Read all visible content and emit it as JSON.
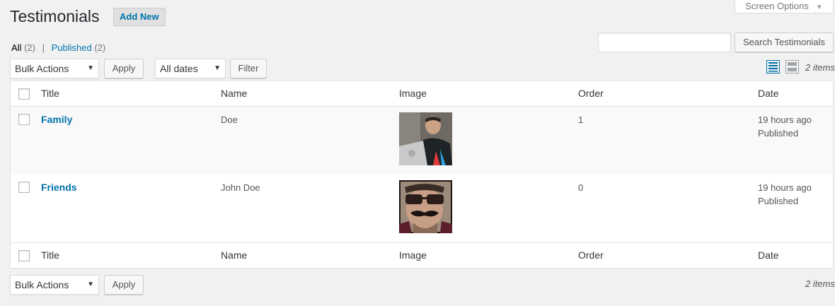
{
  "header": {
    "title": "Testimonials",
    "add_new": "Add New",
    "screen_options": "Screen Options"
  },
  "filters": {
    "all_label": "All",
    "all_count": "(2)",
    "separator": "|",
    "published_label": "Published",
    "published_count": "(2)"
  },
  "search": {
    "value": "",
    "button": "Search Testimonials"
  },
  "top_nav": {
    "bulk_actions": "Bulk Actions",
    "apply": "Apply",
    "dates": "All dates",
    "filter": "Filter",
    "items": "2 items"
  },
  "bottom_nav": {
    "bulk_actions": "Bulk Actions",
    "apply": "Apply",
    "items": "2 items"
  },
  "columns": {
    "title": "Title",
    "name": "Name",
    "image": "Image",
    "order": "Order",
    "date": "Date"
  },
  "rows": [
    {
      "title": "Family",
      "name": "Doe",
      "order": "1",
      "date": "19 hours ago",
      "status": "Published",
      "image": "man-with-laptop-photo"
    },
    {
      "title": "Friends",
      "name": "John Doe",
      "order": "0",
      "date": "19 hours ago",
      "status": "Published",
      "image": "man-with-mustache-sunglasses-photo"
    }
  ],
  "icons": {
    "list_view": "list-view-icon",
    "excerpt_view": "excerpt-view-icon",
    "dropdown": "chevron-down-icon"
  },
  "colors": {
    "link": "#0073aa",
    "background": "#f1f1f1",
    "active_view": "#0073aa"
  }
}
